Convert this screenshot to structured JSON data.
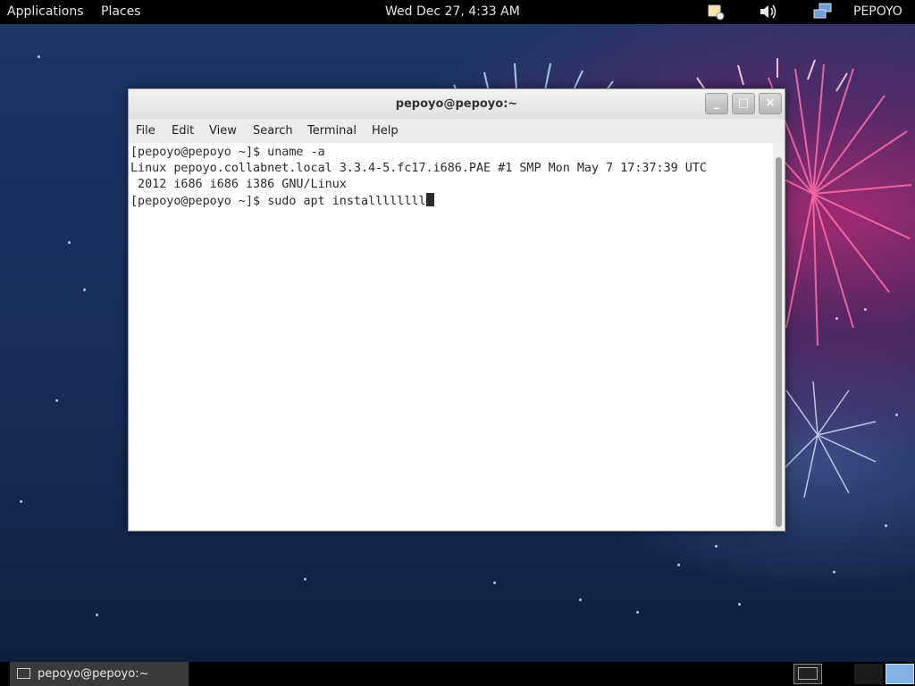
{
  "topbar": {
    "applications": "Applications",
    "places": "Places",
    "clock": "Wed Dec 27,  4:33 AM",
    "user": "PEPOYO",
    "icons": [
      "notification-icon",
      "volume-icon",
      "network-icon"
    ]
  },
  "window": {
    "title": "pepoyo@pepoyo:~",
    "buttons": {
      "minimize": "_",
      "maximize": "□",
      "close": "×"
    },
    "menu": [
      "File",
      "Edit",
      "View",
      "Search",
      "Terminal",
      "Help"
    ]
  },
  "terminal": {
    "lines": [
      "[pepoyo@pepoyo ~]$ uname -a",
      "Linux pepoyo.collabnet.local 3.3.4-5.fc17.i686.PAE #1 SMP Mon May 7 17:37:39 UTC",
      " 2012 i686 i686 i386 GNU/Linux",
      "[pepoyo@pepoyo ~]$ sudo apt installllllll"
    ]
  },
  "taskbar": {
    "task_label": "pepoyo@pepoyo:~"
  },
  "colors": {
    "panel": "#000000",
    "window_bg": "#ffffff",
    "text": "#2b2b2b"
  }
}
